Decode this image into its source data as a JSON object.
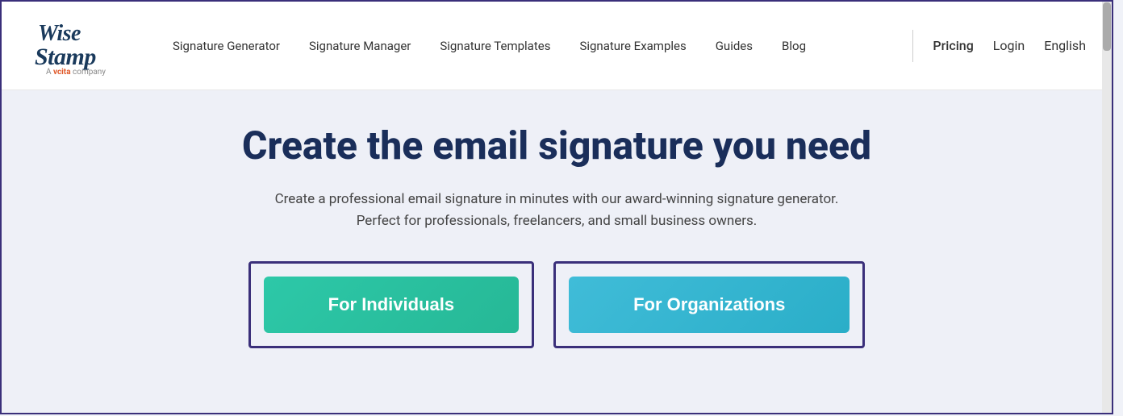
{
  "logo": {
    "brand": "WiseStamp",
    "tagline": "A vcita company",
    "vcita_highlight": "vcita"
  },
  "nav": {
    "links": [
      {
        "label": "Signature Generator",
        "id": "signature-generator"
      },
      {
        "label": "Signature Manager",
        "id": "signature-manager"
      },
      {
        "label": "Signature Templates",
        "id": "signature-templates"
      },
      {
        "label": "Signature Examples",
        "id": "signature-examples"
      },
      {
        "label": "Guides",
        "id": "guides"
      },
      {
        "label": "Blog",
        "id": "blog"
      }
    ],
    "pricing": "Pricing",
    "login": "Login",
    "language": "English"
  },
  "hero": {
    "title": "Create the email signature you need",
    "subtitle_line1": "Create a professional email signature in minutes with our award-winning signature generator.",
    "subtitle_line2": "Perfect for professionals, freelancers, and small business owners.",
    "cta_individuals": "For Individuals",
    "cta_organizations": "For Organizations"
  },
  "colors": {
    "logo_dark": "#1a3a5c",
    "nav_border": "#3a2f7a",
    "title_color": "#1a2e5a",
    "btn_teal": "#2dc8a8",
    "btn_blue": "#40bcd8"
  }
}
